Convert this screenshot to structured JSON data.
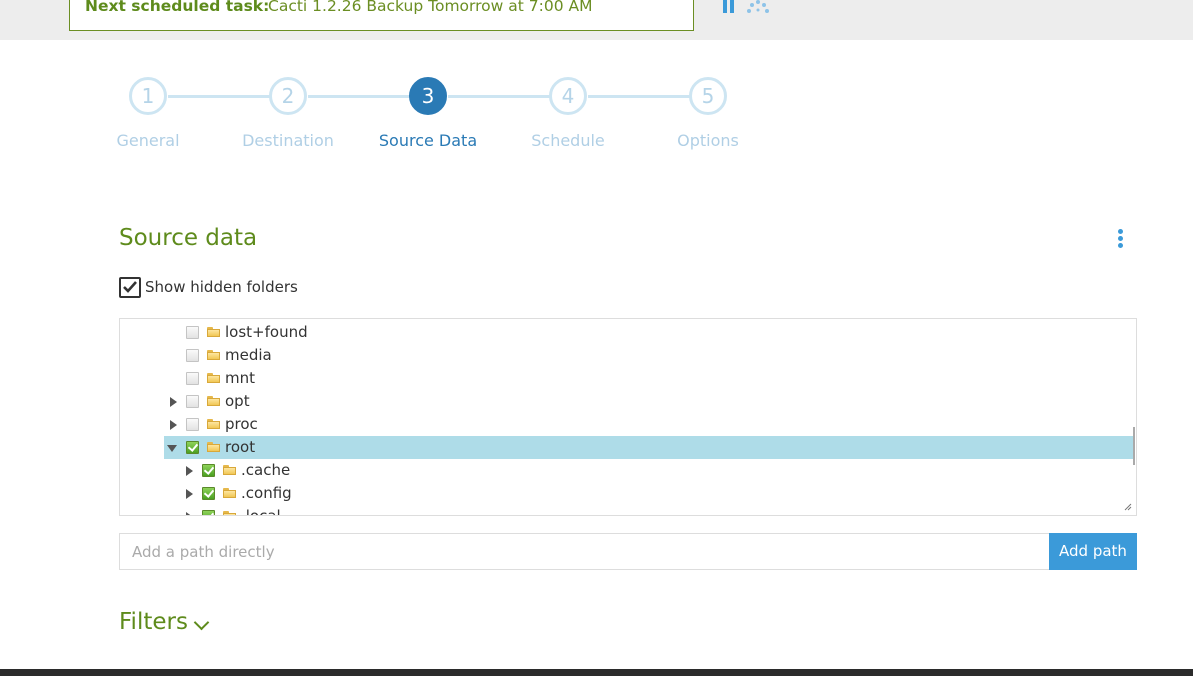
{
  "top_bar": {
    "next_task_label": "Next scheduled task:",
    "next_task_value": "Cacti 1.2.26 Backup Tomorrow at 7:00 AM",
    "pause_icon": "pause-icon",
    "spinner_icon": "loading-spinner-icon"
  },
  "stepper": {
    "steps": [
      {
        "number": "1",
        "label": "General"
      },
      {
        "number": "2",
        "label": "Destination"
      },
      {
        "number": "3",
        "label": "Source Data"
      },
      {
        "number": "4",
        "label": "Schedule"
      },
      {
        "number": "5",
        "label": "Options"
      }
    ],
    "active_step": 3
  },
  "source": {
    "title": "Source data",
    "show_hidden_label": "Show hidden folders",
    "show_hidden_checked": true,
    "tree": [
      {
        "name": "lost+found",
        "expander": "none",
        "checked": false
      },
      {
        "name": "media",
        "expander": "none",
        "checked": false
      },
      {
        "name": "mnt",
        "expander": "none",
        "checked": false
      },
      {
        "name": "opt",
        "expander": "collapsed",
        "checked": false
      },
      {
        "name": "proc",
        "expander": "collapsed",
        "checked": false
      },
      {
        "name": "root",
        "expander": "expanded",
        "checked": true,
        "selected": true
      },
      {
        "name": ".cache",
        "expander": "collapsed",
        "checked": true
      },
      {
        "name": ".config",
        "expander": "collapsed",
        "checked": true
      },
      {
        "name": ".local",
        "expander": "collapsed",
        "checked": true
      }
    ],
    "add_path_placeholder": "Add a path directly",
    "add_path_button": "Add path"
  },
  "filters": {
    "title": "Filters"
  },
  "colors": {
    "accent_blue": "#2a7ab5",
    "button_blue": "#3b9ad9",
    "heading_green": "#5e8b1c",
    "selection": "#aedce8"
  }
}
